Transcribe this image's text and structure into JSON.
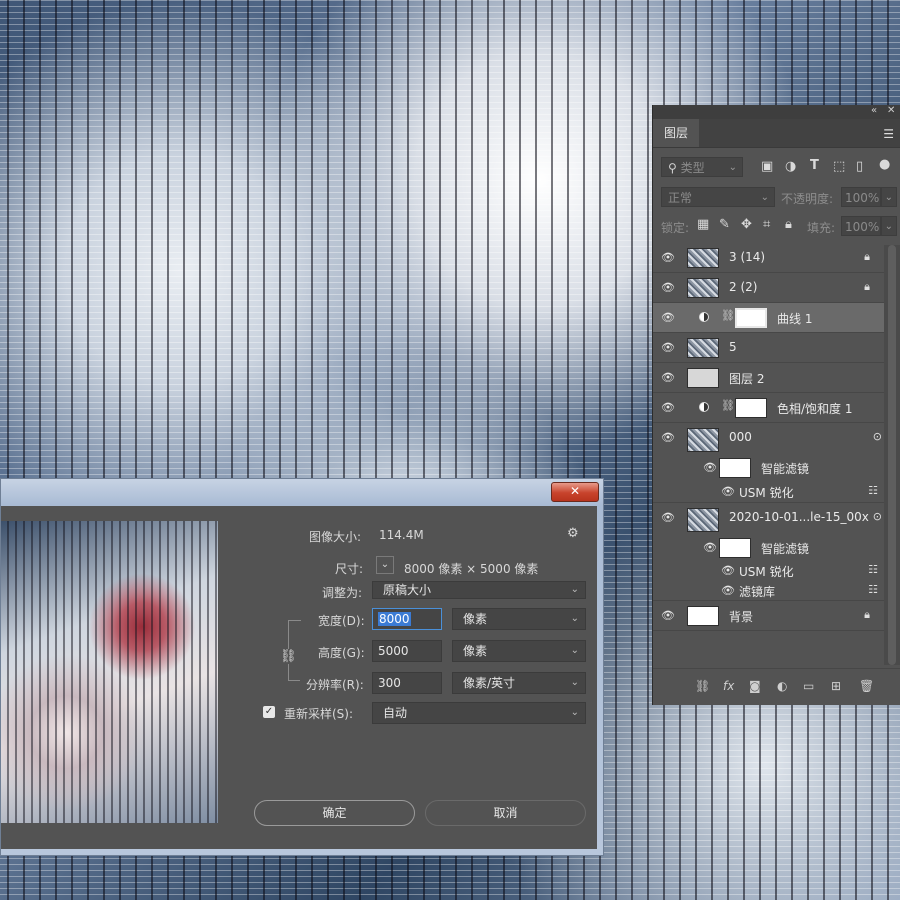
{
  "layers_panel": {
    "tab_title": "图层",
    "filter_kind": "类型",
    "blend_mode": "正常",
    "opacity_label": "不透明度:",
    "opacity_value": "100%",
    "lock_label": "锁定:",
    "fill_label": "填充:",
    "fill_value": "100%",
    "layers": [
      {
        "name": "3 (14)",
        "type": "pixel",
        "locked": true
      },
      {
        "name": "2 (2)",
        "type": "pixel",
        "locked": true
      },
      {
        "name": "曲线 1",
        "type": "adjustment",
        "selected": true
      },
      {
        "name": "5",
        "type": "pixel"
      },
      {
        "name": "图层 2",
        "type": "pixel"
      },
      {
        "name": "色相/饱和度 1",
        "type": "adjustment"
      },
      {
        "name": "000",
        "type": "smart"
      },
      {
        "name": "智能滤镜",
        "type": "smart-filter-group"
      },
      {
        "name": "USM 锐化",
        "type": "filter"
      },
      {
        "name": "2020-10-01...le-15_00x",
        "type": "smart"
      },
      {
        "name": "智能滤镜",
        "type": "smart-filter-group"
      },
      {
        "name": "USM 锐化",
        "type": "filter"
      },
      {
        "name": "滤镜库",
        "type": "filter"
      },
      {
        "name": "背景",
        "type": "background",
        "locked": true
      }
    ]
  },
  "dialog": {
    "close_label": "✕",
    "image_size_label": "图像大小:",
    "image_size_value": "114.4M",
    "dimensions_label": "尺寸:",
    "dimensions_value": "8000 像素 × 5000 像素",
    "fit_to_label": "调整为:",
    "fit_to_value": "原稿大小",
    "width_label": "宽度(D):",
    "width_value": "8000",
    "width_unit": "像素",
    "height_label": "高度(G):",
    "height_value": "5000",
    "height_unit": "像素",
    "resolution_label": "分辨率(R):",
    "resolution_value": "300",
    "resolution_unit": "像素/英寸",
    "resample_label": "重新采样(S):",
    "resample_value": "自动",
    "resample_checked": true,
    "ok_label": "确定",
    "cancel_label": "取消"
  }
}
